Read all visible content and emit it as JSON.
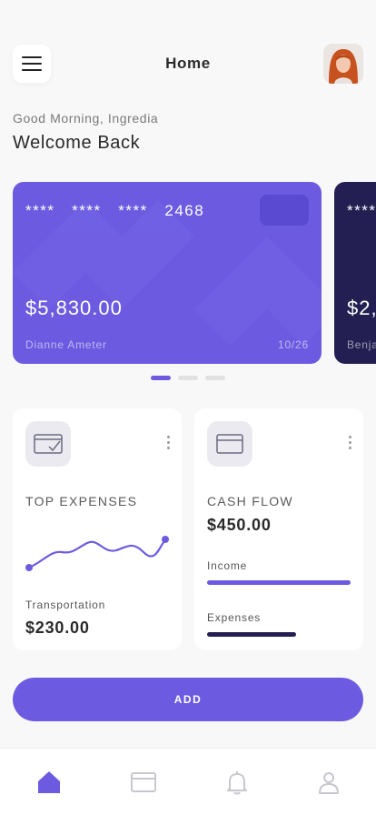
{
  "header": {
    "title": "Home",
    "menu_icon": "hamburger-menu-icon",
    "avatar": "user-avatar"
  },
  "greeting": "Good Morning, Ingredia",
  "welcome": "Welcome Back",
  "cards": [
    {
      "number": "****   ****   ****   2468",
      "balance": "$5,830.00",
      "holder": "Dianne Ameter",
      "expiry": "10/26",
      "color": "#6c5be0"
    },
    {
      "number": "****",
      "balance": "$2,",
      "holder": "Benja",
      "color": "#231f52"
    }
  ],
  "carousel": {
    "count": 3,
    "active": 0
  },
  "top_expenses": {
    "icon": "wallet-check-icon",
    "label": "TOP EXPENSES",
    "category": "Transportation",
    "amount": "$230.00"
  },
  "cash_flow": {
    "icon": "credit-card-icon",
    "label": "CASH FLOW",
    "amount": "$450.00",
    "income_label": "Income",
    "income_fraction": 1.0,
    "expenses_label": "Expenses",
    "expenses_fraction": 0.62
  },
  "add_button": "ADD",
  "tabs": [
    {
      "name": "home",
      "icon": "home-icon",
      "active": true
    },
    {
      "name": "cards",
      "icon": "card-icon",
      "active": false
    },
    {
      "name": "notifications",
      "icon": "bell-icon",
      "active": false
    },
    {
      "name": "profile",
      "icon": "user-icon",
      "active": false
    }
  ],
  "colors": {
    "accent": "#6c5be0",
    "dark": "#231f52",
    "background": "#f8f8f8"
  }
}
